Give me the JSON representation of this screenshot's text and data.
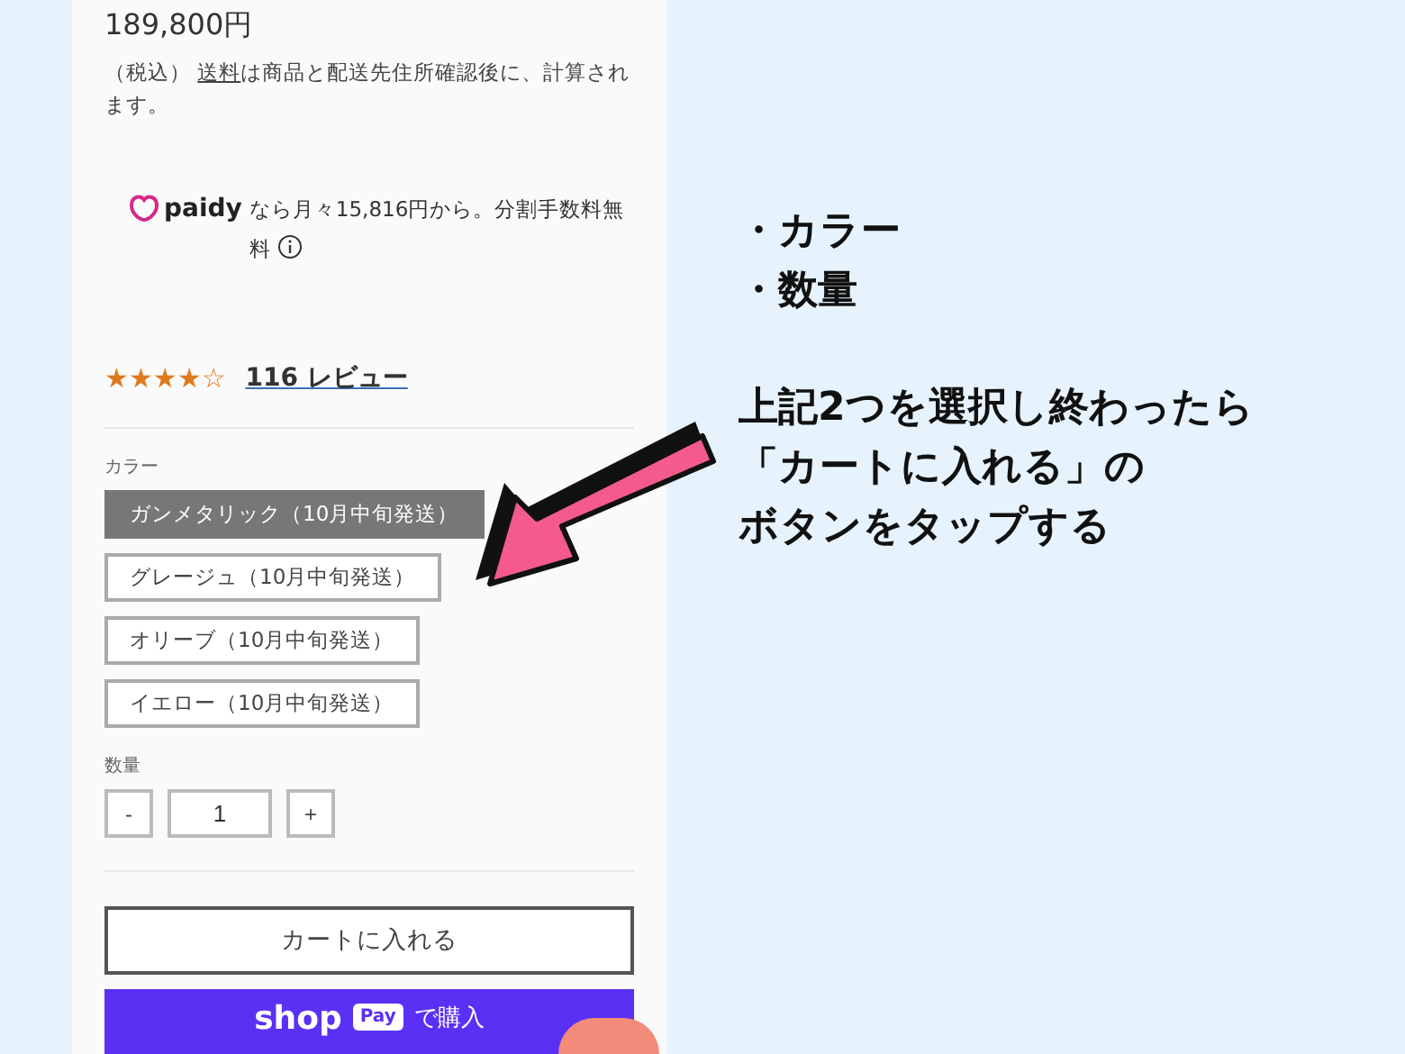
{
  "product": {
    "price": "189,800円",
    "tax_prefix": "（税込）",
    "shipping_link": "送料",
    "tax_rest": "は商品と配送先住所確認後に、計算されます。"
  },
  "paidy": {
    "logo": "paidy",
    "message": "なら月々15,816円から。分割手数料無料"
  },
  "rating": {
    "stars": 4,
    "reviews": "116 レビュー"
  },
  "color": {
    "label": "カラー",
    "options": [
      {
        "label": "ガンメタリック（10月中旬発送）",
        "selected": true
      },
      {
        "label": "グレージュ（10月中旬発送）",
        "selected": false
      },
      {
        "label": "オリーブ（10月中旬発送）",
        "selected": false
      },
      {
        "label": "イエロー（10月中旬発送）",
        "selected": false
      }
    ]
  },
  "quantity": {
    "label": "数量",
    "minus": "-",
    "value": "1",
    "plus": "+"
  },
  "add_to_cart": "カートに入れる",
  "shop_pay": {
    "brand": "shop",
    "badge": "Pay",
    "text": "で購入"
  },
  "annotation": {
    "bullets": [
      "・カラー",
      "・数量"
    ],
    "lines": [
      "上記2つを選択し終わったら",
      "「カートに入れる」の",
      "ボタンをタップする"
    ]
  }
}
